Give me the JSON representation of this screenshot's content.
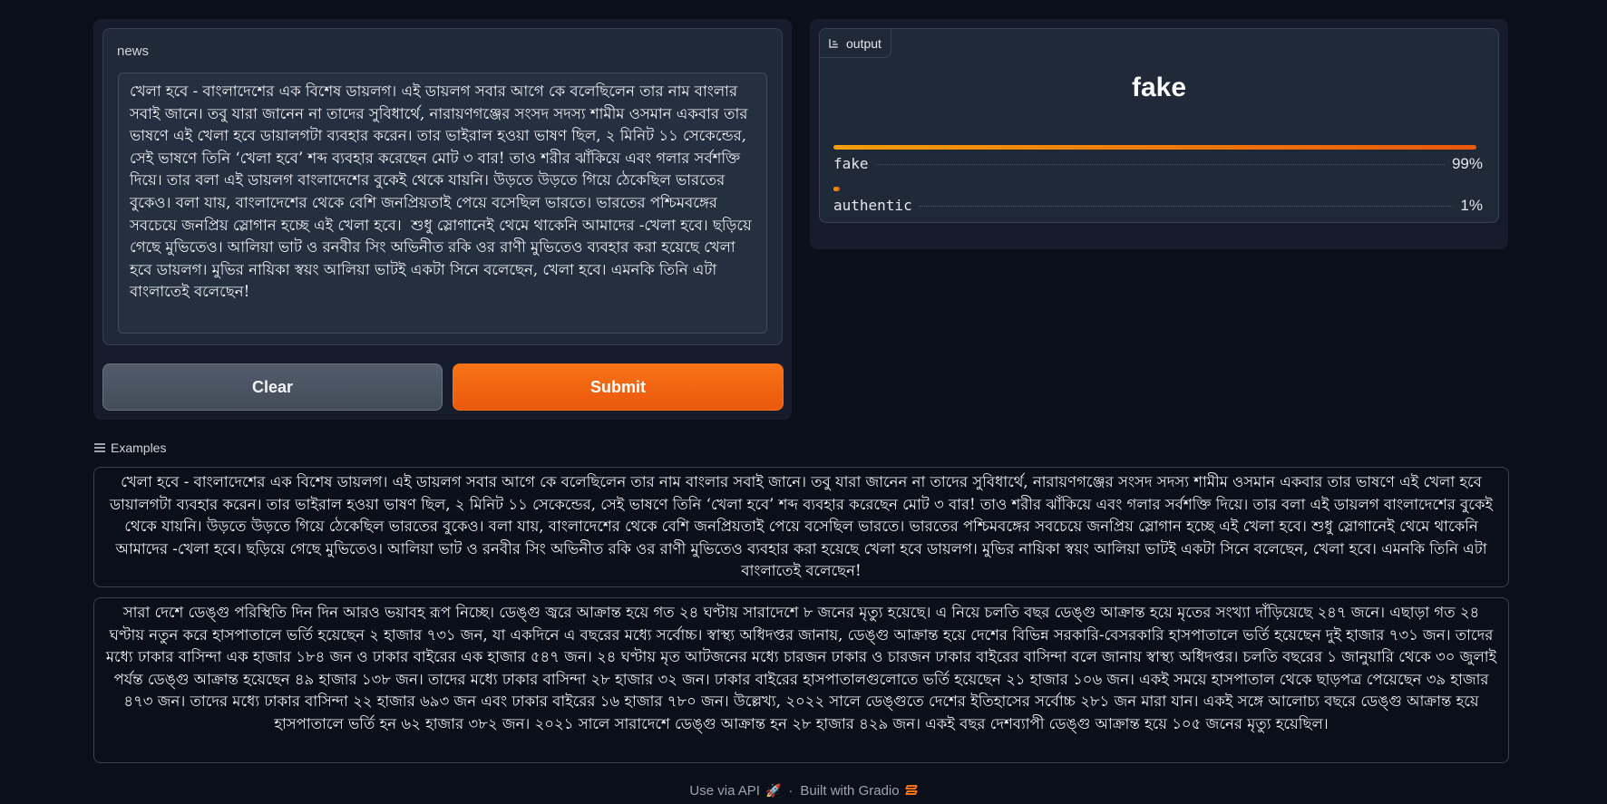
{
  "input": {
    "label": "news",
    "value": "খেলা হবে - বাংলাদেশের এক বিশেষ ডায়লগ। এই ডায়লগ সবার আগে কে বলেছিলেন তার নাম বাংলার সবাই জানে। তবু যারা জানেন না তাদের সুবিধার্থে, নারায়ণগঞ্জের সংসদ সদস্য শামীম ওসমান একবার তার ভাষণে এই খেলা হবে ডায়ালগটা ব্যবহার করেন। তার ভাইরাল হওয়া ভাষণ ছিল, ২ মিনিট ১১ সেকেন্ডের, সেই ভাষণে তিনি ‘খেলা হবে’ শব্দ ব্যবহার করেছেন মোট ৩ বার! তাও শরীর ঝাঁকিয়ে এবং গলার সর্বশক্তি দিয়ে। তার বলা এই ডায়লগ বাংলাদেশের বুকেই থেকে যায়নি। উড়তে উড়তে গিয়ে ঠেকেছিল ভারতের বুকেও। বলা যায়, বাংলাদেশের থেকে বেশি জনপ্রিয়তাই পেয়ে বসেছিল ভারতে। ভারতের পশ্চিমবঙ্গের সবচেয়ে জনপ্রিয় স্লোগান হচ্ছে এই খেলা হবে।  শুধু স্লোগানেই থেমে থাকেনি আমাদের -খেলা হবে। ছড়িয়ে গেছে মুভিতেও। আলিয়া ভাট ও রনবীর সিং অভিনীত রকি ওর রাণী মুভিতেও ব্যবহার করা হয়েছে খেলা হবে ডায়লগ। মুভির নায়িকা স্বয়ং আলিয়া ভাটই একটা সিনে বলেছেন, খেলা হবে। এমনকি তিনি এটা বাংলাতেই বলেছেন!"
  },
  "buttons": {
    "clear": "Clear",
    "submit": "Submit"
  },
  "output": {
    "tag": "output",
    "label": "fake",
    "confidences": [
      {
        "label": "fake",
        "value": 0.99,
        "pct": "99%"
      },
      {
        "label": "authentic",
        "value": 0.01,
        "pct": "1%"
      }
    ],
    "accent": "#f97316"
  },
  "examples": {
    "title": "Examples",
    "items": [
      "খেলা হবে - বাংলাদেশের এক বিশেষ ডায়লগ। এই ডায়লগ সবার আগে কে বলেছিলেন তার নাম বাংলার সবাই জানে। তবু যারা জানেন না তাদের সুবিধার্থে, নারায়ণগঞ্জের সংসদ সদস্য শামীম ওসমান একবার তার ভাষণে এই খেলা হবে ডায়ালগটা ব্যবহার করেন। তার ভাইরাল হওয়া ভাষণ ছিল, ২ মিনিট ১১ সেকেন্ডের, সেই ভাষণে তিনি ‘খেলা হবে’ শব্দ ব্যবহার করেছেন মোট ৩ বার! তাও শরীর ঝাঁকিয়ে এবং গলার সর্বশক্তি দিয়ে। তার বলা এই ডায়লগ বাংলাদেশের বুকেই থেকে যায়নি। উড়তে উড়তে গিয়ে ঠেকেছিল ভারতের বুকেও। বলা যায়, বাংলাদেশের থেকে বেশি জনপ্রিয়তাই পেয়ে বসেছিল ভারতে। ভারতের পশ্চিমবঙ্গের সবচেয়ে জনপ্রিয় স্লোগান হচ্ছে এই খেলা হবে। শুধু স্লোগানেই থেমে থাকেনি আমাদের -খেলা হবে। ছড়িয়ে গেছে মুভিতেও। আলিয়া ভাট ও রনবীর সিং অভিনীত রকি ওর রাণী মুভিতেও ব্যবহার করা হয়েছে খেলা হবে ডায়লগ। মুভির নায়িকা স্বয়ং আলিয়া ভাটই একটা সিনে বলেছেন, খেলা হবে। এমনকি তিনি এটা বাংলাতেই বলেছেন!",
      "সারা দেশে ডেঙ্গু পরিস্থিতি দিন দিন আরও ভয়াবহ রূপ নিচ্ছে। ডেঙ্গু জ্বরে আক্রান্ত হয়ে গত ২৪ ঘণ্টায় সারাদেশে ৮ জনের মৃত্যু হয়েছে। এ নিয়ে চলতি বছর ডেঙ্গু আক্রান্ত হয়ে মৃতের সংখ্যা দাঁড়িয়েছে ২৪৭ জনে। এছাড়া গত ২৪ ঘণ্টায় নতুন করে হাসপাতালে ভর্তি হয়েছেন ২ হাজার ৭৩১ জন, যা একদিনে এ বছরের মধ্যে সর্বোচ্চ। স্বাস্থ্য অধিদপ্তর জানায়, ডেঙ্গু আক্রান্ত হয়ে দেশের বিভিন্ন সরকারি-বেসরকারি হাসপাতালে ভর্তি হয়েছেন দুই হাজার ৭৩১ জন। তাদের মধ্যে ঢাকার বাসিন্দা এক হাজার ১৮৪ জন ও ঢাকার বাইরের এক হাজার ৫৪৭ জন। ২৪ ঘণ্টায় মৃত আটজনের মধ্যে চারজন ঢাকার ও চারজন ঢাকার বাইরের বাসিন্দা বলে জানায় স্বাস্থ্য অধিদপ্তর। চলতি বছরের ১ জানুয়ারি থেকে ৩০ জুলাই পর্যন্ত ডেঙ্গু আক্রান্ত হয়েছেন ৪৯ হাজার ১৩৮ জন। তাদের মধ্যে ঢাকার বাসিন্দা ২৮ হাজার ৩২ জন। ঢাকার বাইরের হাসপাতালগুলোতে ভর্তি হয়েছেন ২১ হাজার ১০৬ জন। একই সময়ে হাসপাতাল থেকে ছাড়পত্র পেয়েছেন ৩৯ হাজার ৪৭৩ জন। তাদের মধ্যে ঢাকার বাসিন্দা ২২ হাজার ৬৯৩ জন এবং ঢাকার বাইরের ১৬ হাজার ৭৮০ জন। উল্লেখ্য, ২০২২ সালে ডেঙ্গুতে দেশের ইতিহাসের সর্বোচ্চ ২৮১ জন মারা যান। একই সঙ্গে আলোচ্য বছরে ডেঙ্গু আক্রান্ত হয়ে হাসপাতালে ভর্তি হন ৬২ হাজার ৩৮২ জন। ২০২১ সালে সারাদেশে ডেঙ্গু আক্রান্ত হন ২৮ হাজার ৪২৯ জন। একই বছর দেশব্যাপী ডেঙ্গু আক্রান্ত হয়ে ১০৫ জনের মৃত্যু হয়েছিল।"
    ]
  },
  "footer": {
    "api": "Use via API",
    "separator": "·",
    "built": "Built with Gradio"
  }
}
